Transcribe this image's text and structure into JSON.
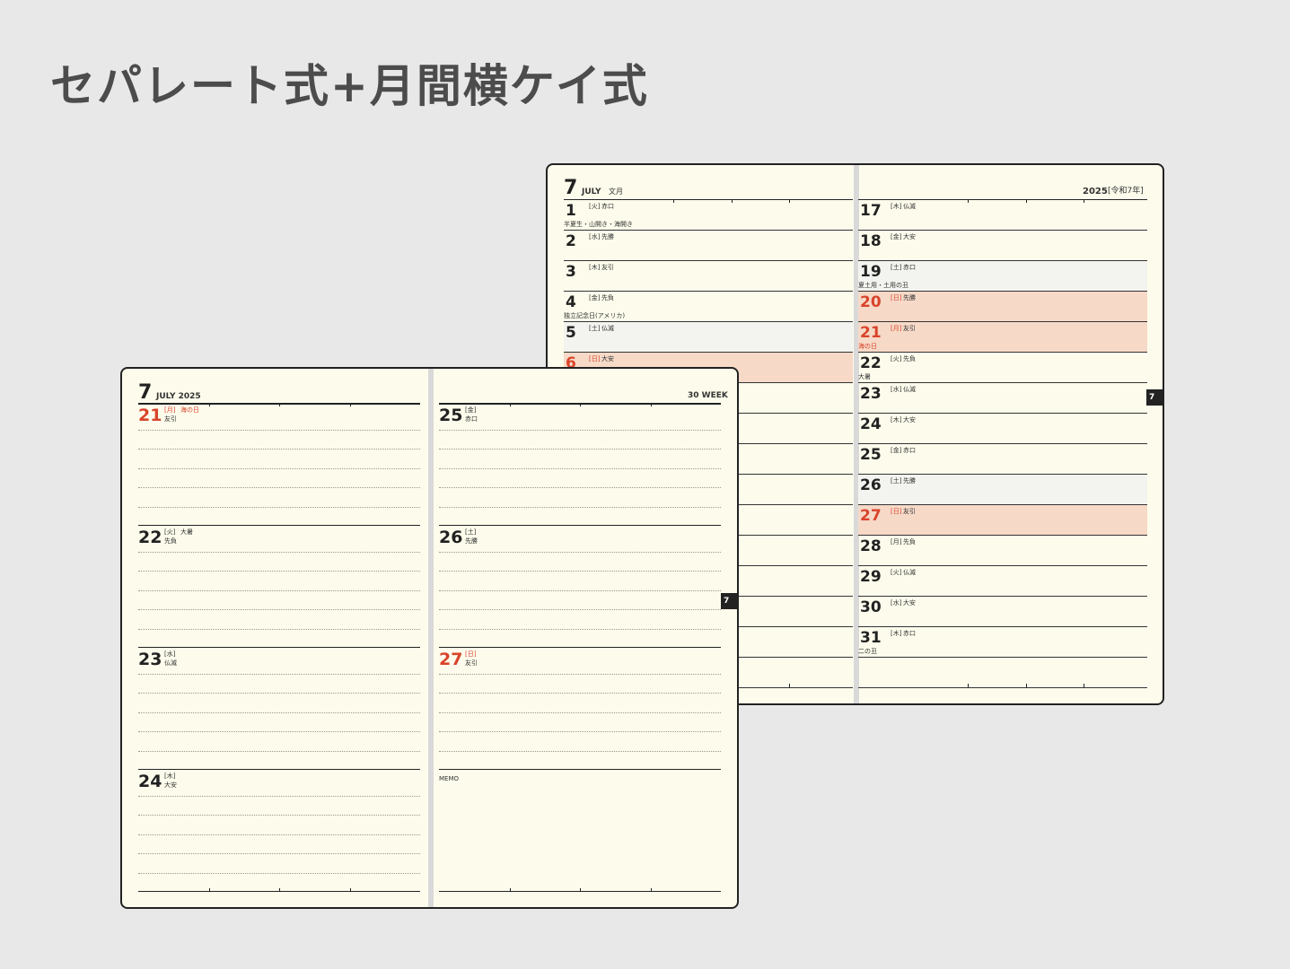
{
  "title": "セパレート式+月間横ケイ式",
  "colors": {
    "paper": "#fdfcec",
    "red": "#d9442b",
    "holiday_band": "#f6d9c7",
    "saturday_band": "#f3f3ef",
    "tab": "#222222"
  },
  "monthly": {
    "month_num": "7",
    "month_en": "JULY",
    "month_jp": "文月",
    "year_label": "2025",
    "era_label": "[令和7年]",
    "tab_label": "7",
    "left_days": [
      {
        "num": "1",
        "dow": "[火]",
        "rokuyo": "赤口",
        "note": "半夏生・山開き・海開き",
        "style": "normal"
      },
      {
        "num": "2",
        "dow": "[水]",
        "rokuyo": "先勝",
        "note": "",
        "style": "normal"
      },
      {
        "num": "3",
        "dow": "[木]",
        "rokuyo": "友引",
        "note": "",
        "style": "normal"
      },
      {
        "num": "4",
        "dow": "[金]",
        "rokuyo": "先負",
        "note": "独立記念日(アメリカ)",
        "style": "normal"
      },
      {
        "num": "5",
        "dow": "[土]",
        "rokuyo": "仏滅",
        "note": "",
        "style": "sat"
      },
      {
        "num": "6",
        "dow": "[日]",
        "rokuyo": "大安",
        "note": "",
        "style": "sun"
      }
    ],
    "right_days": [
      {
        "num": "17",
        "dow": "[木]",
        "rokuyo": "仏滅",
        "note": "",
        "style": "normal"
      },
      {
        "num": "18",
        "dow": "[金]",
        "rokuyo": "大安",
        "note": "",
        "style": "normal"
      },
      {
        "num": "19",
        "dow": "[土]",
        "rokuyo": "赤口",
        "note": "夏土用・土用の丑",
        "style": "sat"
      },
      {
        "num": "20",
        "dow": "[日]",
        "rokuyo": "先勝",
        "note": "",
        "style": "sun"
      },
      {
        "num": "21",
        "dow": "[月]",
        "rokuyo": "友引",
        "note": "海の日",
        "style": "sun"
      },
      {
        "num": "22",
        "dow": "[火]",
        "rokuyo": "先負",
        "note": "大暑",
        "style": "normal"
      },
      {
        "num": "23",
        "dow": "[水]",
        "rokuyo": "仏滅",
        "note": "",
        "style": "normal"
      },
      {
        "num": "24",
        "dow": "[木]",
        "rokuyo": "大安",
        "note": "",
        "style": "normal"
      },
      {
        "num": "25",
        "dow": "[金]",
        "rokuyo": "赤口",
        "note": "",
        "style": "normal"
      },
      {
        "num": "26",
        "dow": "[土]",
        "rokuyo": "先勝",
        "note": "",
        "style": "sat"
      },
      {
        "num": "27",
        "dow": "[日]",
        "rokuyo": "友引",
        "note": "",
        "style": "sun"
      },
      {
        "num": "28",
        "dow": "[月]",
        "rokuyo": "先負",
        "note": "",
        "style": "normal"
      },
      {
        "num": "29",
        "dow": "[火]",
        "rokuyo": "仏滅",
        "note": "",
        "style": "normal"
      },
      {
        "num": "30",
        "dow": "[水]",
        "rokuyo": "大安",
        "note": "",
        "style": "normal"
      },
      {
        "num": "31",
        "dow": "[木]",
        "rokuyo": "赤口",
        "note": "二の丑",
        "style": "normal"
      }
    ]
  },
  "weekly": {
    "month_num": "7",
    "month_en": "JULY 2025",
    "week_label": "30 WEEK",
    "tab_label": "7",
    "memo_label": "MEMO",
    "left_days": [
      {
        "num": "21",
        "dow": "[月]",
        "holiday": "海の日",
        "rokuyo": "友引",
        "style": "red"
      },
      {
        "num": "22",
        "dow": "[火]",
        "holiday": "大暑",
        "rokuyo": "先負",
        "style": "normal"
      },
      {
        "num": "23",
        "dow": "[水]",
        "holiday": "",
        "rokuyo": "仏滅",
        "style": "normal"
      },
      {
        "num": "24",
        "dow": "[木]",
        "holiday": "",
        "rokuyo": "大安",
        "style": "normal"
      }
    ],
    "right_days": [
      {
        "num": "25",
        "dow": "[金]",
        "holiday": "",
        "rokuyo": "赤口",
        "style": "normal"
      },
      {
        "num": "26",
        "dow": "[土]",
        "holiday": "",
        "rokuyo": "先勝",
        "style": "normal"
      },
      {
        "num": "27",
        "dow": "[日]",
        "holiday": "",
        "rokuyo": "友引",
        "style": "red"
      }
    ]
  }
}
